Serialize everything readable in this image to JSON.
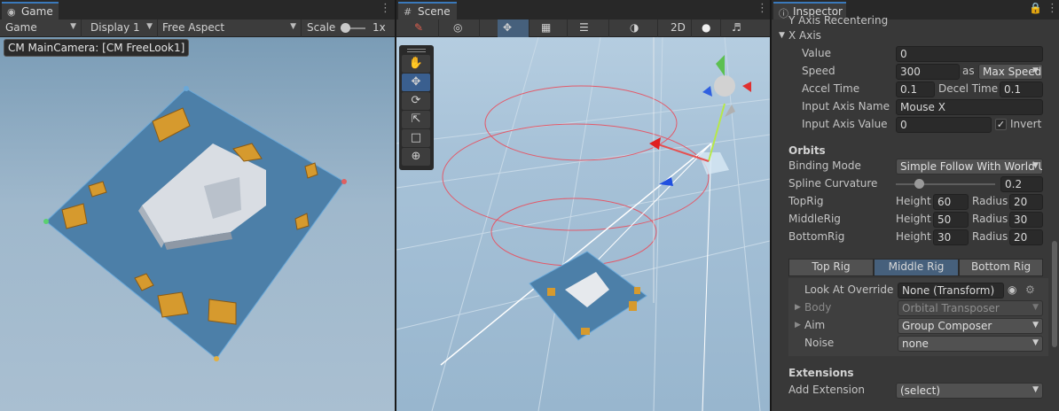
{
  "game": {
    "tab": "Game",
    "toolbar": {
      "mode": "Game",
      "display": "Display 1",
      "aspect": "Free Aspect",
      "scale_label": "Scale",
      "scale_value": "1x"
    },
    "camera_label": "CM MainCamera: [CM FreeLook1]"
  },
  "scene": {
    "tab": "Scene",
    "toolbar": {
      "mode_2d": "2D"
    }
  },
  "inspector": {
    "tab": "Inspector",
    "cutoff_label": "Y Axis Recentering",
    "x_axis": {
      "header": "X Axis",
      "value_label": "Value",
      "value": "0",
      "speed_label": "Speed",
      "speed": "300",
      "speed_as": "as",
      "speed_mode": "Max Speed",
      "accel_label": "Accel Time",
      "accel": "0.1",
      "decel_label": "Decel Time",
      "decel": "0.1",
      "input_name_label": "Input Axis Name",
      "input_name": "Mouse X",
      "input_value_label": "Input Axis Value",
      "input_value": "0",
      "invert_label": "Invert"
    },
    "orbits": {
      "header": "Orbits",
      "binding_label": "Binding Mode",
      "binding": "Simple Follow With World Up",
      "spline_label": "Spline Curvature",
      "spline": "0.2",
      "spline_fraction": 0.2,
      "height_label": "Height",
      "radius_label": "Radius",
      "rigs": [
        {
          "name": "TopRig",
          "height": "60",
          "radius": "20"
        },
        {
          "name": "MiddleRig",
          "height": "50",
          "radius": "30"
        },
        {
          "name": "BottomRig",
          "height": "30",
          "radius": "20"
        }
      ]
    },
    "rig_tabs": {
      "top": "Top Rig",
      "middle": "Middle Rig",
      "bottom": "Bottom Rig"
    },
    "rig": {
      "look_at_label": "Look At Override",
      "look_at": "None (Transform)",
      "body_label": "Body",
      "body": "Orbital Transposer",
      "aim_label": "Aim",
      "aim": "Group Composer",
      "noise_label": "Noise",
      "noise": "none"
    },
    "extensions": {
      "header": "Extensions",
      "add_label": "Add Extension",
      "add_value": "(select)"
    }
  }
}
